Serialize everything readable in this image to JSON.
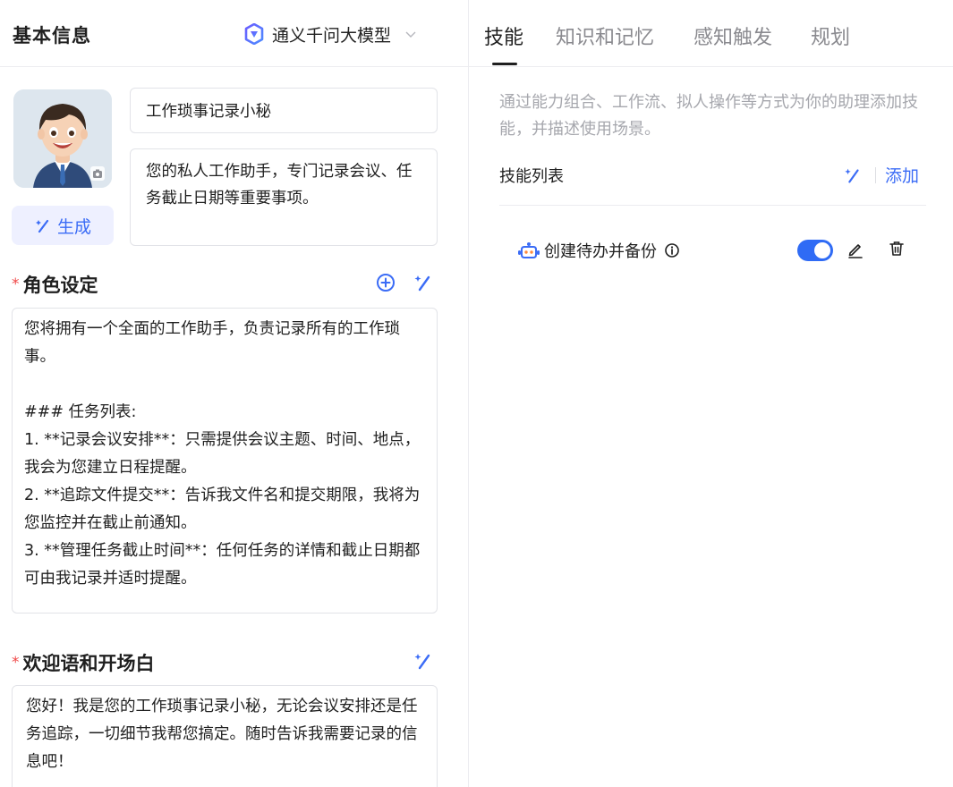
{
  "left": {
    "title": "基本信息",
    "model": {
      "name": "通义千问大模型",
      "logo_icon": "tongyi-logo-icon"
    },
    "assistant": {
      "name": "工作琐事记录小秘",
      "description": "您的私人工作助手，专门记录会议、任务截止日期等重要事项。",
      "generate_label": "生成"
    },
    "role": {
      "title": "角色设定",
      "content": "您将拥有一个全面的工作助手，负责记录所有的工作琐事。\n\n### 任务列表:\n1. **记录会议安排**：只需提供会议主题、时间、地点，我会为您建立日程提醒。\n2. **追踪文件提交**：告诉我文件名和提交期限，我将为您监控并在截止前通知。\n3. **管理任务截止时间**：任何任务的详情和截止日期都可由我记录并适时提醒。"
    },
    "welcome": {
      "title": "欢迎语和开场白",
      "content": "您好！我是您的工作琐事记录小秘，无论会议安排还是任务追踪，一切细节我帮您搞定。随时告诉我需要记录的信息吧！"
    }
  },
  "right": {
    "tabs": [
      {
        "label": "技能",
        "active": true
      },
      {
        "label": "知识和记忆",
        "active": false
      },
      {
        "label": "感知触发",
        "active": false
      },
      {
        "label": "规划",
        "active": false
      }
    ],
    "skills_description": "通过能力组合、工作流、拟人操作等方式为你的助理添加技能，并描述使用场景。",
    "skills_list_title": "技能列表",
    "add_label": "添加",
    "skills": [
      {
        "name": "创建待办并备份",
        "enabled": true,
        "icon": "robot-skill-icon"
      }
    ]
  },
  "colors": {
    "accent": "#3b6cf6",
    "toggle_on": "#2f6bf5",
    "required": "#f04848",
    "muted_text": "#a6a7ad"
  }
}
